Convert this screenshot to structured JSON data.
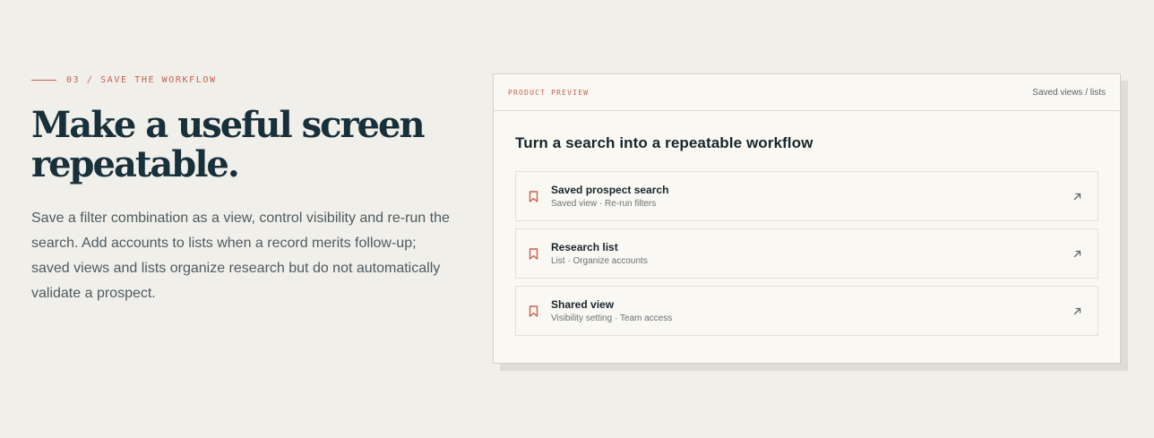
{
  "section": {
    "eyebrow": "03 / SAVE THE WORKFLOW",
    "headline_line1": "Make a useful screen",
    "headline_line2": "repeatable.",
    "body": "Save a filter combination as a view, control visibility and re-run the search. Add accounts to lists when a record merits follow-up; saved views and lists organize research but do not automatically validate a prospect."
  },
  "preview": {
    "label": "PRODUCT PREVIEW",
    "meta": "Saved views / lists",
    "title": "Turn a search into a repeatable workflow",
    "items": [
      {
        "title": "Saved prospect search",
        "subtitle": "Saved view · Re-run filters",
        "icon": "bookmark-icon"
      },
      {
        "title": "Research list",
        "subtitle": "List · Organize accounts",
        "icon": "bookmark-icon"
      },
      {
        "title": "Shared view",
        "subtitle": "Visibility setting · Team access",
        "icon": "bookmark-icon"
      }
    ]
  },
  "colors": {
    "accent": "#c8604e",
    "background": "#f0efea",
    "card": "#faf8f2",
    "ink": "#17303a"
  }
}
